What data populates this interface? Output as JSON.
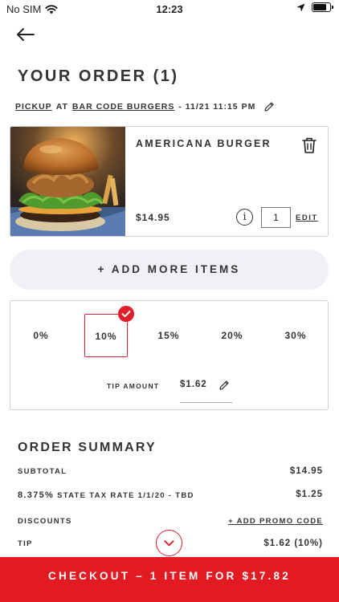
{
  "status_bar": {
    "carrier": "No SIM",
    "time": "12:23"
  },
  "header": {
    "title": "YOUR ORDER (1)"
  },
  "pickup": {
    "mode": "PICKUP",
    "at": "AT",
    "location": "BAR CODE BURGERS",
    "datetime": "- 11/21 11:15 PM"
  },
  "item": {
    "name": "AMERICANA BURGER",
    "price": "$14.95",
    "quantity": "1",
    "edit_label": "EDIT",
    "info_glyph": "i"
  },
  "add_more_label": "+ ADD MORE ITEMS",
  "tip": {
    "options": [
      "0%",
      "10%",
      "15%",
      "20%",
      "30%"
    ],
    "selected": "10%",
    "amount_label": "TIP AMOUNT",
    "amount": "$1.62"
  },
  "summary": {
    "title": "ORDER SUMMARY",
    "subtotal_label": "SUBTOTAL",
    "subtotal": "$14.95",
    "tax_rate": "8.375%",
    "tax_label": "STATE TAX RATE 1/1/20 - TBD",
    "tax": "$1.25",
    "discounts_label": "DISCOUNTS",
    "promo_label": "+ ADD PROMO CODE",
    "tip_label": "TIP",
    "tip_value": "$1.62 (10%)"
  },
  "checkout_label": "CHECKOUT – 1 ITEM FOR $17.82",
  "colors": {
    "accent": "#e21b23",
    "pill": "#f1f1f5",
    "border": "#cfcfcf"
  },
  "icons": [
    "back-arrow-icon",
    "pencil-icon",
    "trash-icon",
    "info-icon",
    "check-icon",
    "chevron-down-icon",
    "wifi-icon",
    "location-arrow-icon",
    "battery-icon"
  ]
}
